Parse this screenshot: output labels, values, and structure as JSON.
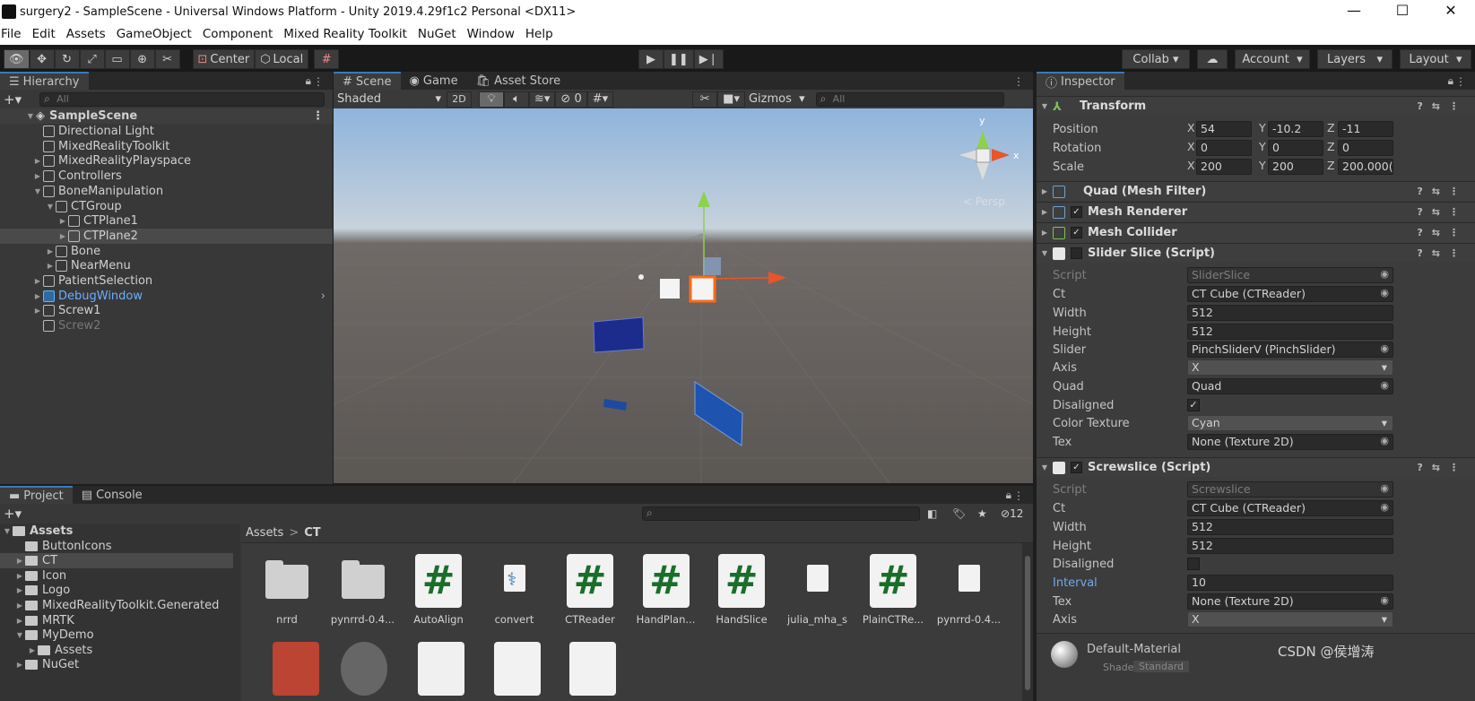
{
  "window": {
    "title": "surgery2 - SampleScene - Universal Windows Platform - Unity 2019.4.29f1c2 Personal <DX11>"
  },
  "menu": [
    "File",
    "Edit",
    "Assets",
    "GameObject",
    "Component",
    "Mixed Reality Toolkit",
    "NuGet",
    "Window",
    "Help"
  ],
  "toolbar": {
    "pivot": "Center",
    "space": "Local",
    "collab": "Collab",
    "account": "Account",
    "layers": "Layers",
    "layout": "Layout"
  },
  "hierarchy": {
    "tab": "Hierarchy",
    "search_placeholder": "All",
    "scene": "SampleScene",
    "items": [
      {
        "label": "Directional Light"
      },
      {
        "label": "MixedRealityToolkit"
      },
      {
        "label": "MixedRealityPlayspace"
      },
      {
        "label": "Controllers"
      },
      {
        "label": "BoneManipulation"
      },
      {
        "label": "CTGroup"
      },
      {
        "label": "CTPlane1"
      },
      {
        "label": "CTPlane2"
      },
      {
        "label": "Bone"
      },
      {
        "label": "NearMenu"
      },
      {
        "label": "PatientSelection"
      },
      {
        "label": "DebugWindow"
      },
      {
        "label": "Screw1"
      },
      {
        "label": "Screw2"
      }
    ]
  },
  "scene_view": {
    "tabs": [
      "Scene",
      "Game",
      "Asset Store"
    ],
    "shading": "Shaded",
    "mode2d": "2D",
    "hidden_count": "0",
    "gizmos": "Gizmos",
    "search_placeholder": "All",
    "persp": "< Persp",
    "axis_x": "x",
    "axis_y": "y"
  },
  "project": {
    "tabs": [
      "Project",
      "Console"
    ],
    "filter_count": "12",
    "breadcrumb": [
      "Assets",
      "CT"
    ],
    "tree": [
      {
        "label": "Assets"
      },
      {
        "label": "ButtonIcons"
      },
      {
        "label": "CT"
      },
      {
        "label": "Icon"
      },
      {
        "label": "Logo"
      },
      {
        "label": "MixedRealityToolkit.Generated"
      },
      {
        "label": "MRTK"
      },
      {
        "label": "MyDemo"
      },
      {
        "label": "Assets"
      },
      {
        "label": "NuGet"
      }
    ],
    "assets": [
      {
        "label": "nrrd",
        "kind": "folder"
      },
      {
        "label": "pynrrd-0.4...",
        "kind": "folder"
      },
      {
        "label": "AutoAlign",
        "kind": "script"
      },
      {
        "label": "convert",
        "kind": "python"
      },
      {
        "label": "CTReader",
        "kind": "script"
      },
      {
        "label": "HandPlan...",
        "kind": "script"
      },
      {
        "label": "HandSlice",
        "kind": "script"
      },
      {
        "label": "julia_mha_s",
        "kind": "file"
      },
      {
        "label": "PlainCTRe...",
        "kind": "script"
      },
      {
        "label": "pynrrd-0.4...",
        "kind": "file"
      }
    ]
  },
  "inspector": {
    "tab": "Inspector",
    "transform": {
      "title": "Transform",
      "position": {
        "label": "Position",
        "x": "54",
        "y": "-10.2",
        "z": "-11"
      },
      "rotation": {
        "label": "Rotation",
        "x": "0",
        "y": "0",
        "z": "0"
      },
      "scale": {
        "label": "Scale",
        "x": "200",
        "y": "200",
        "z": "200.000("
      }
    },
    "components": {
      "mesh_filter": "Quad (Mesh Filter)",
      "mesh_renderer": "Mesh Renderer",
      "mesh_collider": "Mesh Collider",
      "slider_slice": "Slider Slice (Script)",
      "screwslice": "Screwslice (Script)"
    },
    "slider_slice": {
      "script": "SliderSlice",
      "ct": "CT Cube (CTReader)",
      "width": "512",
      "height": "512",
      "slider": "PinchSliderV (PinchSlider)",
      "axis": "X",
      "quad": "Quad",
      "disaligned": "✓",
      "color_texture": "Cyan",
      "tex": "None (Texture 2D)"
    },
    "screwslice": {
      "script": "Screwslice",
      "ct": "CT Cube (CTReader)",
      "width": "512",
      "height": "512",
      "disaligned": "",
      "interval": "10",
      "tex": "None (Texture 2D)",
      "axis": "X"
    },
    "labels": {
      "script": "Script",
      "ct": "Ct",
      "width": "Width",
      "height": "Height",
      "slider": "Slider",
      "axis": "Axis",
      "quad": "Quad",
      "disaligned": "Disaligned",
      "color_texture": "Color Texture",
      "tex": "Tex",
      "interval": "Interval"
    },
    "material": "Default-Material",
    "shader_label": "Shader",
    "shader": "Standard"
  },
  "watermark": "CSDN @侯增涛"
}
